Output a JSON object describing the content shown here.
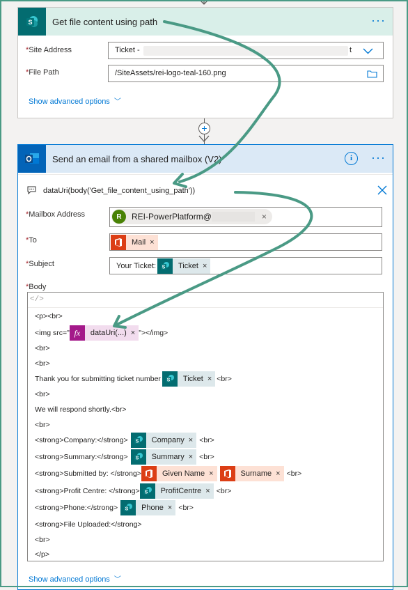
{
  "card1": {
    "title": "Get file content using path",
    "more_label": "···",
    "site_address_label": "Site Address",
    "site_address_value": "Ticket -",
    "site_address_suffix": "t",
    "file_path_label": "File Path",
    "file_path_value": "/SiteAssets/rei-logo-teal-160.png",
    "show_advanced": "Show advanced options"
  },
  "card2": {
    "title": "Send an email from a shared mailbox (V2)",
    "more_label": "···",
    "info_label": "i",
    "comment": "dataUri(body('Get_file_content_using_path'))",
    "mailbox_label": "Mailbox Address",
    "mailbox_avatar": "R",
    "mailbox_value": "REI-PowerPlatform@",
    "to_label": "To",
    "to_token": "Mail",
    "subject_label": "Subject",
    "subject_prefix": "Your Ticket:",
    "subject_token": "Ticket",
    "body_label": "Body",
    "code_icon": "</>",
    "show_advanced": "Show advanced options",
    "body": {
      "l1": "<p><br>",
      "l2_pre": "<img src=\"",
      "l2_token": "dataUri(...)",
      "l2_post": "\"></img>",
      "l3": "<br>",
      "l4": "<br>",
      "l5_pre": "Thank you for submitting ticket number",
      "l5_token": "Ticket",
      "l5_post": "<br>",
      "l6": "<br>",
      "l7": "We will respond shortly.<br>",
      "l8": "<br>",
      "l9_pre": "<strong>Company:</strong>",
      "l9_token": "Company",
      "l9_post": "<br>",
      "l10_pre": "<strong>Summary:</strong>",
      "l10_token": "Summary",
      "l10_post": "<br>",
      "l11_pre": "<strong>Submitted by: </strong>",
      "l11_token1": "Given Name",
      "l11_token2": "Surname",
      "l11_post": "<br>",
      "l12_pre": "<strong>Profit Centre: </strong>",
      "l12_token": "ProfitCentre",
      "l12_post": "<br>",
      "l13_pre": "<strong>Phone:</strong>",
      "l13_token": "Phone",
      "l13_post": "<br>",
      "l14": "<strong>File Uploaded:</strong>",
      "l15": "<br>",
      "l16": "</p>"
    }
  },
  "common": {
    "required_mark": "*",
    "remove_mark": "×",
    "add_mark": "+"
  },
  "colors": {
    "accent": "#0078d4",
    "annotation_arrow": "#4a9a85",
    "sharepoint": "#036c70",
    "office365": "#dc3e15",
    "expression": "#a4198a"
  }
}
